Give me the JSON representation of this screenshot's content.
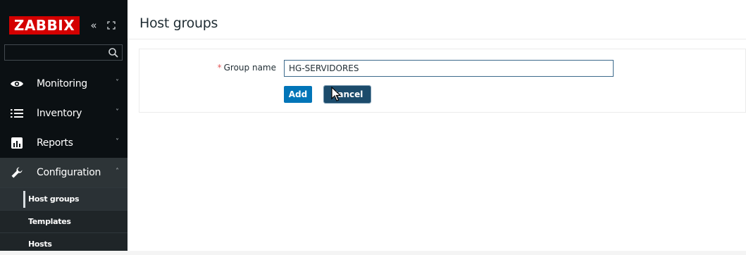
{
  "brand": {
    "logo_text": "ZABBIX",
    "collapse_glyph": "«"
  },
  "search": {
    "value": "",
    "placeholder": ""
  },
  "menu": [
    {
      "label": "Monitoring",
      "icon": "eye-icon",
      "chevron": "˅"
    },
    {
      "label": "Inventory",
      "icon": "list-icon",
      "chevron": "˅"
    },
    {
      "label": "Reports",
      "icon": "bar-chart-icon",
      "chevron": "˅"
    },
    {
      "label": "Configuration",
      "icon": "wrench-icon",
      "chevron": "˄"
    }
  ],
  "submenu": [
    {
      "label": "Host groups"
    },
    {
      "label": "Templates"
    },
    {
      "label": "Hosts"
    }
  ],
  "page": {
    "title": "Host groups"
  },
  "form": {
    "required_mark": "*",
    "group_name_label": "Group name",
    "group_name_value": "HG-SERVIDORES",
    "add_label": "Add",
    "cancel_label": "Cancel"
  },
  "colors": {
    "logo_red": "#d40000",
    "sidebar_bg": "#0b1013",
    "primary_blue": "#0275b8"
  }
}
